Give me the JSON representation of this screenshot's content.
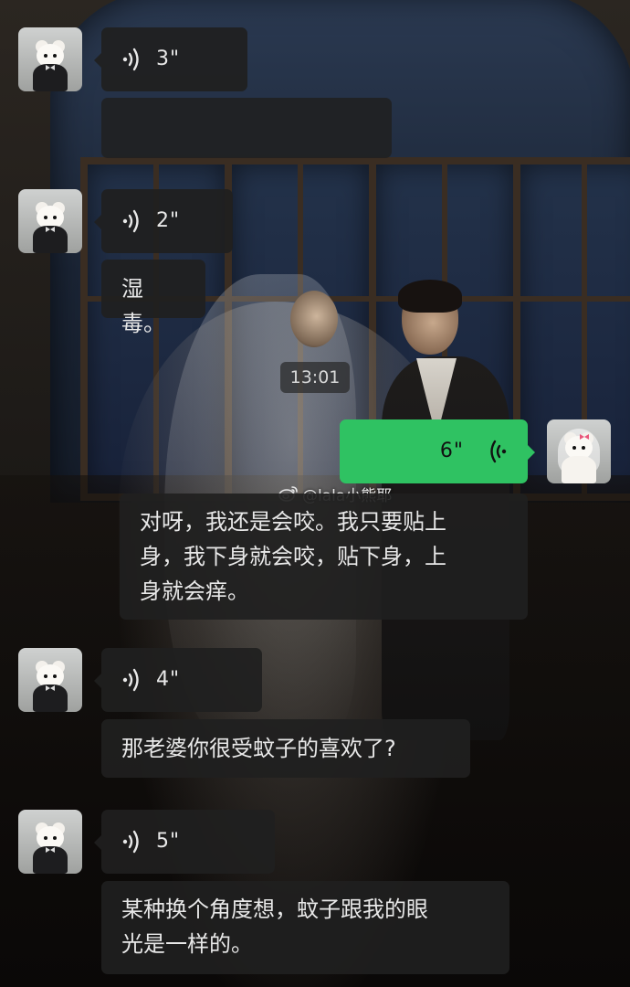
{
  "time_stamp": "13:01",
  "watermark": "@lala小熊耶",
  "messages": [
    {
      "type": "voice",
      "side": "incoming",
      "duration": "3\""
    },
    {
      "type": "text",
      "side": "incoming",
      "text": ""
    },
    {
      "type": "voice",
      "side": "incoming",
      "duration": "2\""
    },
    {
      "type": "text",
      "side": "incoming",
      "text": "湿毒。"
    },
    {
      "type": "voice",
      "side": "outgoing",
      "duration": "6\""
    },
    {
      "type": "text",
      "side": "incoming",
      "lines": [
        "对呀，我还是会咬。我只要贴上",
        "身，我下身就会咬，贴下身，上",
        "身就会痒。"
      ]
    },
    {
      "type": "voice",
      "side": "incoming",
      "duration": "4\""
    },
    {
      "type": "text",
      "side": "incoming",
      "text": "那老婆你很受蚊子的喜欢了?"
    },
    {
      "type": "voice",
      "side": "incoming",
      "duration": "5\""
    },
    {
      "type": "text",
      "side": "incoming",
      "lines": [
        "某种换个角度想，蚊子跟我的眼",
        "光是一样的。"
      ]
    }
  ],
  "icons": {
    "voice_incoming": "voice-wave-icon",
    "voice_outgoing": "voice-wave-icon",
    "watermark_logo": "weibo-logo-icon"
  },
  "colors": {
    "incoming_bubble": "#202020",
    "outgoing_bubble": "#2fc262",
    "incoming_text": "#e8e8e8"
  }
}
